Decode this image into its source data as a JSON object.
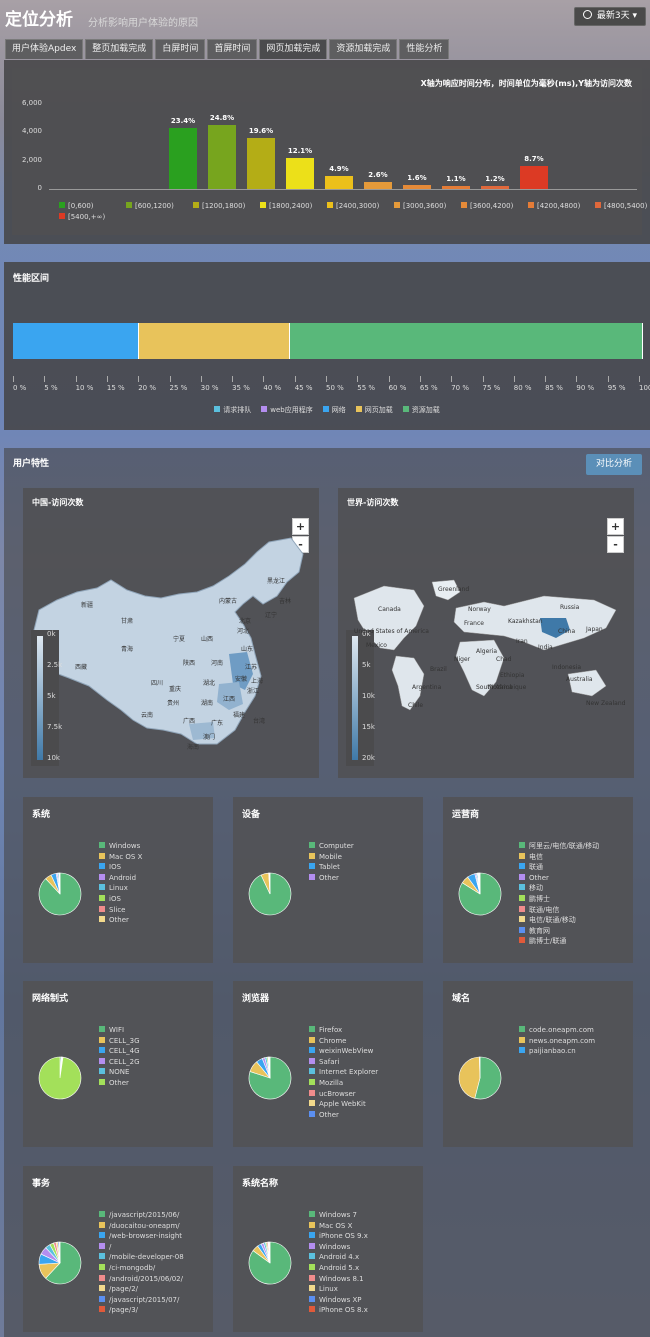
{
  "header": {
    "title": "定位分析",
    "subtitle": "分析影响用户体验的原因",
    "range_button": "最新3天"
  },
  "tabs": [
    {
      "label": "用户体验Apdex",
      "active": false
    },
    {
      "label": "整页加载完成",
      "active": false
    },
    {
      "label": "白屏时间",
      "active": false
    },
    {
      "label": "首屏时间",
      "active": false
    },
    {
      "label": "网页加载完成",
      "active": true
    },
    {
      "label": "资源加载完成",
      "active": false
    },
    {
      "label": "性能分析",
      "active": false
    }
  ],
  "response_chart": {
    "note": "X轴为响应时间分布，时间单位为毫秒(ms),Y轴为访问次数",
    "chart_data": {
      "type": "bar",
      "categories": [
        "[0,600)",
        "[600,1200)",
        "[1200,1800)",
        "[1800,2400)",
        "[2400,3000)",
        "[3000,3600)",
        "[3600,4200)",
        "[4200,4800)",
        "[4800,5400)",
        "[5400,+∞)"
      ],
      "values": [
        4300,
        4550,
        3600,
        2200,
        900,
        480,
        300,
        200,
        220,
        1600
      ],
      "data_labels": [
        "23.4%",
        "24.8%",
        "19.6%",
        "12.1%",
        "4.9%",
        "2.6%",
        "1.6%",
        "1.1%",
        "1.2%",
        "8.7%"
      ],
      "colors": [
        "#2aa01f",
        "#77a51e",
        "#b4ad16",
        "#ece019",
        "#ecc01b",
        "#e59a3a",
        "#e58a38",
        "#e57c37",
        "#e0683b",
        "#dc3a24"
      ],
      "yticks": [
        "6,000",
        "4,000",
        "2,000",
        "0"
      ],
      "ylim": [
        0,
        6000
      ]
    }
  },
  "performance": {
    "title": "性能区间",
    "segments": [
      {
        "name": "网络",
        "from": 0,
        "to": 20,
        "color": "#3aa5f0"
      },
      {
        "name": "网页加载",
        "from": 20,
        "to": 44,
        "color": "#e8c35b"
      },
      {
        "name": "资源加载",
        "from": 44,
        "to": 100,
        "color": "#59b87a"
      }
    ],
    "ticks": [
      "0 %",
      "5 %",
      "10 %",
      "15 %",
      "20 %",
      "25 %",
      "30 %",
      "35 %",
      "40 %",
      "45 %",
      "50 %",
      "55 %",
      "60 %",
      "65 %",
      "70 %",
      "75 %",
      "80 %",
      "85 %",
      "90 %",
      "95 %",
      "100 ..."
    ],
    "legend": [
      {
        "name": "请求排队",
        "color": "#5bc0de"
      },
      {
        "name": "web应用程序",
        "color": "#b48ef0"
      },
      {
        "name": "网络",
        "color": "#3aa5f0"
      },
      {
        "name": "网页加载",
        "color": "#e8c35b"
      },
      {
        "name": "资源加载",
        "color": "#59b87a"
      }
    ]
  },
  "user_features": {
    "title": "用户特性",
    "compare_button": "对比分析",
    "china_map": {
      "title": "中国-访问次数",
      "zoom_in": "+",
      "zoom_out": "-",
      "scale": [
        "0k",
        "2.5k",
        "5k",
        "7.5k",
        "10k"
      ],
      "labels": [
        "黑龙江",
        "吉林",
        "辽宁",
        "内蒙古",
        "新疆",
        "甘肃",
        "宁夏",
        "北京",
        "河北",
        "山西",
        "山东",
        "青海",
        "陕西",
        "河南",
        "江苏",
        "西藏",
        "四川",
        "重庆",
        "湖北",
        "安徽",
        "上海",
        "贵州",
        "湖南",
        "江西",
        "浙江",
        "福建",
        "云南",
        "广西",
        "广东",
        "台湾",
        "海南",
        "澳门"
      ]
    },
    "world_map": {
      "title": "世界-访问次数",
      "zoom_in": "+",
      "zoom_out": "-",
      "scale": [
        "0k",
        "5k",
        "10k",
        "15k",
        "20k"
      ],
      "labels": [
        "Greenland",
        "Canada",
        "Norway",
        "Russia",
        "France",
        "Kazakhstan",
        "United States of America",
        "China",
        "Japan",
        "Mexico",
        "Iran",
        "India",
        "Algeria",
        "Niger",
        "Chad",
        "Ethiopia",
        "Indonesia",
        "Brazil",
        "Mozambique",
        "Argentina",
        "South Africa",
        "Australia",
        "New Zealand",
        "Chile"
      ]
    }
  },
  "cards": [
    {
      "title": "系统",
      "legend": [
        {
          "name": "Windows",
          "color": "#59b87a"
        },
        {
          "name": "Mac OS X",
          "color": "#e8c35b"
        },
        {
          "name": "IOS",
          "color": "#3aa5f0"
        },
        {
          "name": "Android",
          "color": "#b48ef0"
        },
        {
          "name": "Linux",
          "color": "#5bc0de"
        },
        {
          "name": "iOS",
          "color": "#a3e05a"
        },
        {
          "name": "Slice",
          "color": "#f08c8c"
        },
        {
          "name": "Other",
          "color": "#f2d98c"
        }
      ],
      "pie": [
        88,
        5,
        4,
        1,
        1,
        0.5,
        0.3,
        0.2
      ]
    },
    {
      "title": "设备",
      "legend": [
        {
          "name": "Computer",
          "color": "#59b87a"
        },
        {
          "name": "Mobile",
          "color": "#e8c35b"
        },
        {
          "name": "Tablet",
          "color": "#3aa5f0"
        },
        {
          "name": "Other",
          "color": "#b48ef0"
        }
      ],
      "pie": [
        93,
        6,
        0.5,
        0.5
      ]
    },
    {
      "title": "运营商",
      "legend": [
        {
          "name": "阿里云/电信/联通/移动",
          "color": "#59b87a"
        },
        {
          "name": "电信",
          "color": "#e8c35b"
        },
        {
          "name": "联通",
          "color": "#3aa5f0"
        },
        {
          "name": "Other",
          "color": "#b48ef0"
        },
        {
          "name": "移动",
          "color": "#5bc0de"
        },
        {
          "name": "鹏博士",
          "color": "#a3e05a"
        },
        {
          "name": "联通/电信",
          "color": "#f08c8c"
        },
        {
          "name": "电信/联通/移动",
          "color": "#f2d98c"
        },
        {
          "name": "教育网",
          "color": "#5b8ff0"
        },
        {
          "name": "鹏博士/联通",
          "color": "#e05a3a"
        }
      ],
      "pie": [
        84,
        6,
        6,
        1,
        1,
        0.5,
        0.5,
        0.5,
        0.3,
        0.2
      ]
    },
    {
      "title": "网络制式",
      "legend": [
        {
          "name": "WIFI",
          "color": "#59b87a"
        },
        {
          "name": "CELL_3G",
          "color": "#e8c35b"
        },
        {
          "name": "CELL_4G",
          "color": "#3aa5f0"
        },
        {
          "name": "CELL_2G",
          "color": "#b48ef0"
        },
        {
          "name": "NONE",
          "color": "#5bc0de"
        },
        {
          "name": "Other",
          "color": "#a3e05a"
        }
      ],
      "pie": [
        1,
        0.3,
        0.5,
        0.2,
        0.3,
        97.7
      ]
    },
    {
      "title": "浏览器",
      "legend": [
        {
          "name": "Firefox",
          "color": "#59b87a"
        },
        {
          "name": "Chrome",
          "color": "#e8c35b"
        },
        {
          "name": "weixinWebView",
          "color": "#3aa5f0"
        },
        {
          "name": "Safari",
          "color": "#b48ef0"
        },
        {
          "name": "Internet Explorer",
          "color": "#5bc0de"
        },
        {
          "name": "Mozilla",
          "color": "#a3e05a"
        },
        {
          "name": "ucBrowser",
          "color": "#f08c8c"
        },
        {
          "name": "Apple WebKit",
          "color": "#f2d98c"
        },
        {
          "name": "Other",
          "color": "#5b8ff0"
        }
      ],
      "pie": [
        80,
        9,
        5,
        2,
        1.5,
        1,
        0.5,
        0.5,
        0.5
      ]
    },
    {
      "title": "域名",
      "legend": [
        {
          "name": "code.oneapm.com",
          "color": "#59b87a"
        },
        {
          "name": "news.oneapm.com",
          "color": "#e8c35b"
        },
        {
          "name": "paijianbao.cn",
          "color": "#3aa5f0"
        }
      ],
      "pie": [
        54,
        45.5,
        0.5
      ]
    },
    {
      "title": "事务",
      "legend": [
        {
          "name": "/javascript/2015/06/",
          "color": "#59b87a"
        },
        {
          "name": "/duocaitou-oneapm/",
          "color": "#e8c35b"
        },
        {
          "name": "/web-browser-insight",
          "color": "#3aa5f0"
        },
        {
          "name": "/",
          "color": "#b48ef0"
        },
        {
          "name": "/mobile-developer-08",
          "color": "#5bc0de"
        },
        {
          "name": "/ci-mongodb/",
          "color": "#a3e05a"
        },
        {
          "name": "/android/2015/06/02/",
          "color": "#f08c8c"
        },
        {
          "name": "/page/2/",
          "color": "#f2d98c"
        },
        {
          "name": "/javascript/2015/07/",
          "color": "#5b8ff0"
        },
        {
          "name": "/page/3/",
          "color": "#e05a3a"
        }
      ],
      "pie": [
        62,
        12,
        8,
        6,
        4,
        3,
        2,
        1.5,
        1,
        0.5
      ]
    },
    {
      "title": "系统名称",
      "legend": [
        {
          "name": "Windows 7",
          "color": "#59b87a"
        },
        {
          "name": "Mac OS X",
          "color": "#e8c35b"
        },
        {
          "name": "iPhone OS 9.x",
          "color": "#3aa5f0"
        },
        {
          "name": "Windows",
          "color": "#b48ef0"
        },
        {
          "name": "Android 4.x",
          "color": "#5bc0de"
        },
        {
          "name": "Android 5.x",
          "color": "#a3e05a"
        },
        {
          "name": "Windows 8.1",
          "color": "#f08c8c"
        },
        {
          "name": "Linux",
          "color": "#f2d98c"
        },
        {
          "name": "Windows XP",
          "color": "#5b8ff0"
        },
        {
          "name": "iPhone OS 8.x",
          "color": "#e05a3a"
        }
      ],
      "pie": [
        85,
        5,
        3,
        2,
        1.5,
        1,
        1,
        0.5,
        0.5,
        0.5
      ]
    }
  ]
}
